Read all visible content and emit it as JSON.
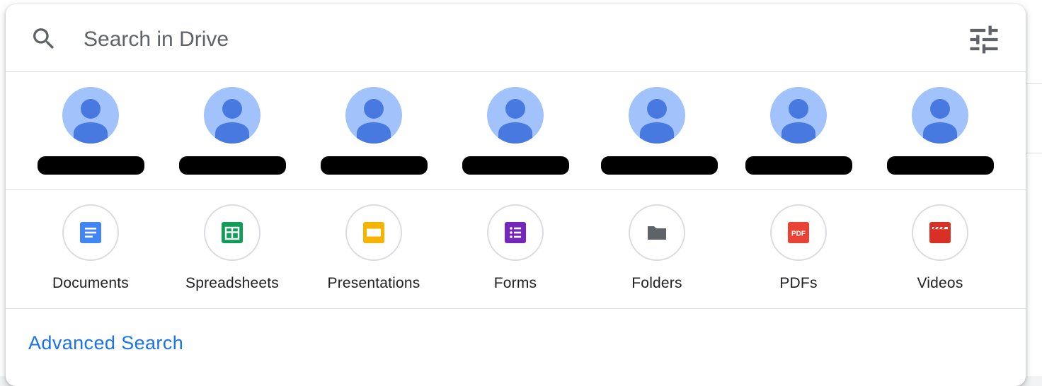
{
  "search": {
    "placeholder": "Search in Drive"
  },
  "people": [
    {
      "name": ""
    },
    {
      "name": ""
    },
    {
      "name": ""
    },
    {
      "name": ""
    },
    {
      "name": ""
    },
    {
      "name": ""
    },
    {
      "name": ""
    }
  ],
  "file_types": [
    {
      "label": "Documents",
      "icon": "docs-icon",
      "color": "#4285f4"
    },
    {
      "label": "Spreadsheets",
      "icon": "sheets-icon",
      "color": "#0f9d58"
    },
    {
      "label": "Presentations",
      "icon": "slides-icon",
      "color": "#f4b400"
    },
    {
      "label": "Forms",
      "icon": "forms-icon",
      "color": "#7627bb"
    },
    {
      "label": "Folders",
      "icon": "folder-icon",
      "color": "#5f6368"
    },
    {
      "label": "PDFs",
      "icon": "pdf-icon",
      "color": "#ea4335",
      "badge": "PDF"
    },
    {
      "label": "Videos",
      "icon": "video-icon",
      "color": "#d93025"
    }
  ],
  "advanced_search": {
    "label": "Advanced Search"
  },
  "colors": {
    "accent": "#1a73e8",
    "avatar_bg": "#a1c2fa",
    "avatar_fg": "#4779e0",
    "divider": "#dadce0"
  }
}
